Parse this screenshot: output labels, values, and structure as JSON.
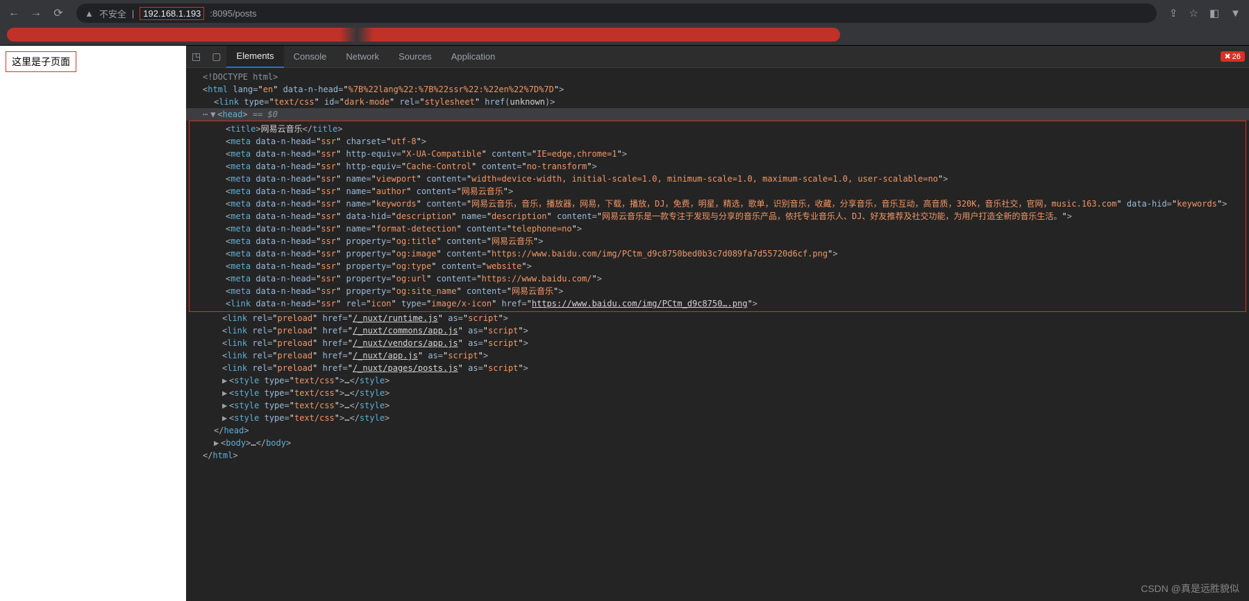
{
  "browser": {
    "security_label": "不安全",
    "url_host": "192.168.1.193",
    "url_port_path": ":8095/posts"
  },
  "page": {
    "content_label": "这里是子页面"
  },
  "devtools": {
    "tabs": {
      "elements": "Elements",
      "console": "Console",
      "network": "Network",
      "sources": "Sources",
      "application": "Application"
    },
    "error_count": "26"
  },
  "code": {
    "doctype": "<!DOCTYPE html>",
    "html_open": {
      "lang": "en",
      "data_n_head": "%7B%22lang%22:%7B%22ssr%22:%22en%22%7D%7D"
    },
    "link_dark": {
      "type": "text/css",
      "id": "dark-mode",
      "rel": "stylesheet",
      "href_text": "unknown"
    },
    "head_selector": " == $0",
    "title": "网易云音乐",
    "meta1": {
      "charset": "utf-8"
    },
    "meta2": {
      "http_equiv": "X-UA-Compatible",
      "content": "IE=edge,chrome=1"
    },
    "meta3": {
      "http_equiv": "Cache-Control",
      "content": "no-transform"
    },
    "meta4": {
      "name": "viewport",
      "content": "width=device-width, initial-scale=1.0, minimum-scale=1.0, maximum-scale=1.0, user-scalable=no"
    },
    "meta5": {
      "name": "author",
      "content": "网易云音乐"
    },
    "meta6": {
      "name": "keywords",
      "content": "网易云音乐，音乐，播放器，网易，下载，播放，DJ，免费，明星，精选，歌单，识别音乐，收藏，分享音乐，音乐互动，高音质，320K，音乐社交，官网，music.163.com",
      "hid": "keywords"
    },
    "meta7": {
      "hid": "description",
      "name": "description",
      "content": "网易云音乐是一款专注于发现与分享的音乐产品，依托专业音乐人、DJ、好友推荐及社交功能，为用户打造全新的音乐生活。"
    },
    "meta8": {
      "name": "format-detection",
      "content": "telephone=no"
    },
    "meta9": {
      "property": "og:title",
      "content": "网易云音乐"
    },
    "meta10": {
      "property": "og:image",
      "content": "https://www.baidu.com/img/PCtm_d9c8750bed0b3c7d089fa7d55720d6cf.png"
    },
    "meta11": {
      "property": "og:type",
      "content": "website"
    },
    "meta12": {
      "property": "og:url",
      "content": "https://www.baidu.com/"
    },
    "meta13": {
      "property": "og:site_name",
      "content": "网易云音乐"
    },
    "link_icon": {
      "rel": "icon",
      "type": "image/x-icon",
      "href": "https://www.baidu.com/img/PCtm_d9c8750….png"
    },
    "preload1": {
      "href": "/_nuxt/runtime.js"
    },
    "preload2": {
      "href": "/_nuxt/commons/app.js"
    },
    "preload3": {
      "href": "/_nuxt/vendors/app.js"
    },
    "preload4": {
      "href": "/_nuxt/app.js"
    },
    "preload5": {
      "href": "/_nuxt/pages/posts.js"
    },
    "style_type": "text/css"
  },
  "watermark": "CSDN @真是远胜貌似"
}
